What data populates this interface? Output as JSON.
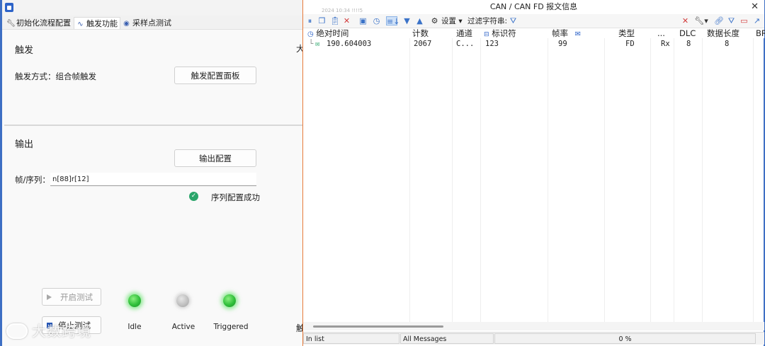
{
  "left": {
    "tabs": [
      {
        "label": "初始化流程配置",
        "icon": "wrench-icon"
      },
      {
        "label": "触发功能",
        "icon": "waveform-icon"
      },
      {
        "label": "采样点测试",
        "icon": "target-icon"
      }
    ],
    "trigger": {
      "section_title": "触发",
      "mode_label": "触发方式：组合帧触发",
      "panel_button": "触发配置面板"
    },
    "output": {
      "section_title": "输出",
      "config_button": "输出配置",
      "sequence_label": "帧/序列：",
      "sequence_value": "n[88]r[12]",
      "success_text": "序列配置成功"
    },
    "controls": {
      "start_button": "开启测试",
      "stop_button": "停止测试"
    },
    "indicators": [
      {
        "label": "Idle",
        "state": "on",
        "color": "#2fbf3a"
      },
      {
        "label": "Active",
        "state": "off",
        "color": "#bdbdbd"
      },
      {
        "label": "Triggered",
        "state": "on",
        "color": "#2fbf3a"
      }
    ],
    "clipped_chars": [
      "大",
      "触"
    ],
    "watermark": "大数跨境"
  },
  "right": {
    "title": "CAN / CAN FD 报文信息",
    "timestamp": "2024 10:34 !!!!5",
    "toolbar": {
      "settings_label": "设置",
      "filter_label": "过滤字符串:"
    },
    "columns": [
      "绝对时间",
      "计数",
      "通道",
      "标识符",
      "帧率",
      "类型",
      "...",
      "DLC",
      "数据长度",
      "BR"
    ],
    "rows": [
      {
        "time": "190.604003",
        "count": "2067",
        "channel": "C...",
        "id": "123",
        "rate": "99",
        "type": "FD",
        "dir": "Rx",
        "dlc": "8",
        "len": "8"
      }
    ],
    "status": {
      "in_list": "In list",
      "filter": "All Messages",
      "progress": "0 %"
    }
  },
  "colors": {
    "accent": "#2d63c8",
    "led_on": "#2fbf3a",
    "led_off": "#bdbdbd",
    "success": "#2aa56a"
  }
}
